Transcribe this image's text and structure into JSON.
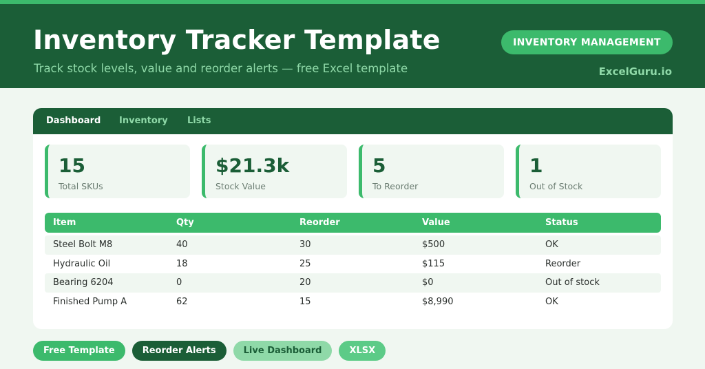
{
  "header": {
    "title": "Inventory Tracker Template",
    "subtitle": "Track stock levels, value and reorder alerts — free Excel template",
    "badge": "INVENTORY MANAGEMENT",
    "brand": "ExcelGuru.io"
  },
  "tabs": [
    {
      "label": "Dashboard",
      "active": true
    },
    {
      "label": "Inventory",
      "active": false
    },
    {
      "label": "Lists",
      "active": false
    }
  ],
  "kpis": [
    {
      "value": "15",
      "label": "Total SKUs"
    },
    {
      "value": "$21.3k",
      "label": "Stock Value"
    },
    {
      "value": "5",
      "label": "To Reorder"
    },
    {
      "value": "1",
      "label": "Out of Stock"
    }
  ],
  "table": {
    "headers": [
      "Item",
      "Qty",
      "Reorder",
      "Value",
      "Status"
    ],
    "rows": [
      [
        "Steel Bolt M8",
        "40",
        "30",
        "$500",
        "OK"
      ],
      [
        "Hydraulic Oil",
        "18",
        "25",
        "$115",
        "Reorder"
      ],
      [
        "Bearing 6204",
        "0",
        "20",
        "$0",
        "Out of stock"
      ],
      [
        "Finished Pump A",
        "62",
        "15",
        "$8,990",
        "OK"
      ]
    ]
  },
  "chips": [
    {
      "label": "Free Template",
      "bg": "#3cba6c",
      "fg": "#ffffff"
    },
    {
      "label": "Reorder Alerts",
      "bg": "#1b5e37",
      "fg": "#ffffff"
    },
    {
      "label": "Live Dashboard",
      "bg": "#8fd9a8",
      "fg": "#1b5e37"
    },
    {
      "label": "XLSX",
      "bg": "#5ccb87",
      "fg": "#ffffff"
    }
  ],
  "colors": {
    "header": "#1b5e37",
    "accent": "#3cba6c",
    "light_accent": "#8fd9a8",
    "page_bg": "#f0f7f1"
  }
}
